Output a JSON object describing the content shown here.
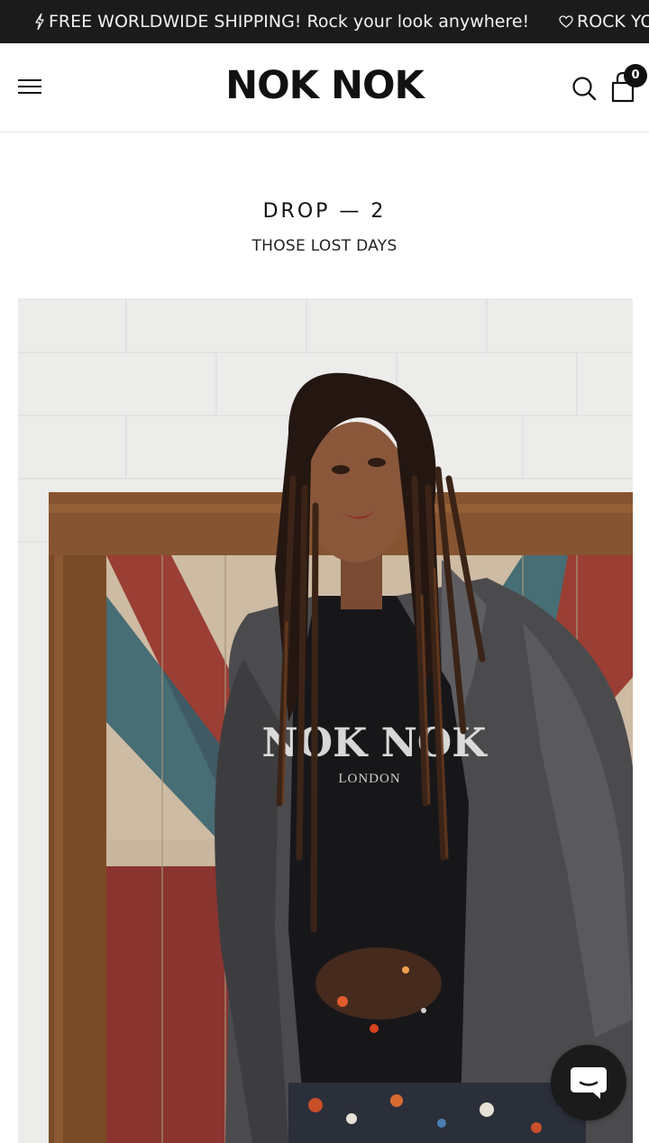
{
  "announcement": {
    "message_1": "FREE WORLDWIDE SHIPPING! Rock your look anywhere!",
    "message_2": "ROCK YO",
    "icon_1": "lightning-icon",
    "icon_2": "heart-icon"
  },
  "header": {
    "logo": "NOK NOK",
    "cart_count": "0",
    "menu_icon": "hamburger-menu-icon",
    "search_icon": "search-icon",
    "cart_icon": "shopping-bag-icon"
  },
  "collection": {
    "title": "DROP — 2",
    "subtitle": "THOSE LOST DAYS"
  },
  "hero": {
    "shirt_print": "NOK NOK",
    "shirt_print_sub": "LONDON"
  },
  "chat": {
    "icon": "chat-bubble-icon"
  },
  "colors": {
    "announcement_bg": "#1b1b1b",
    "text": "#111111",
    "background": "#ffffff"
  }
}
